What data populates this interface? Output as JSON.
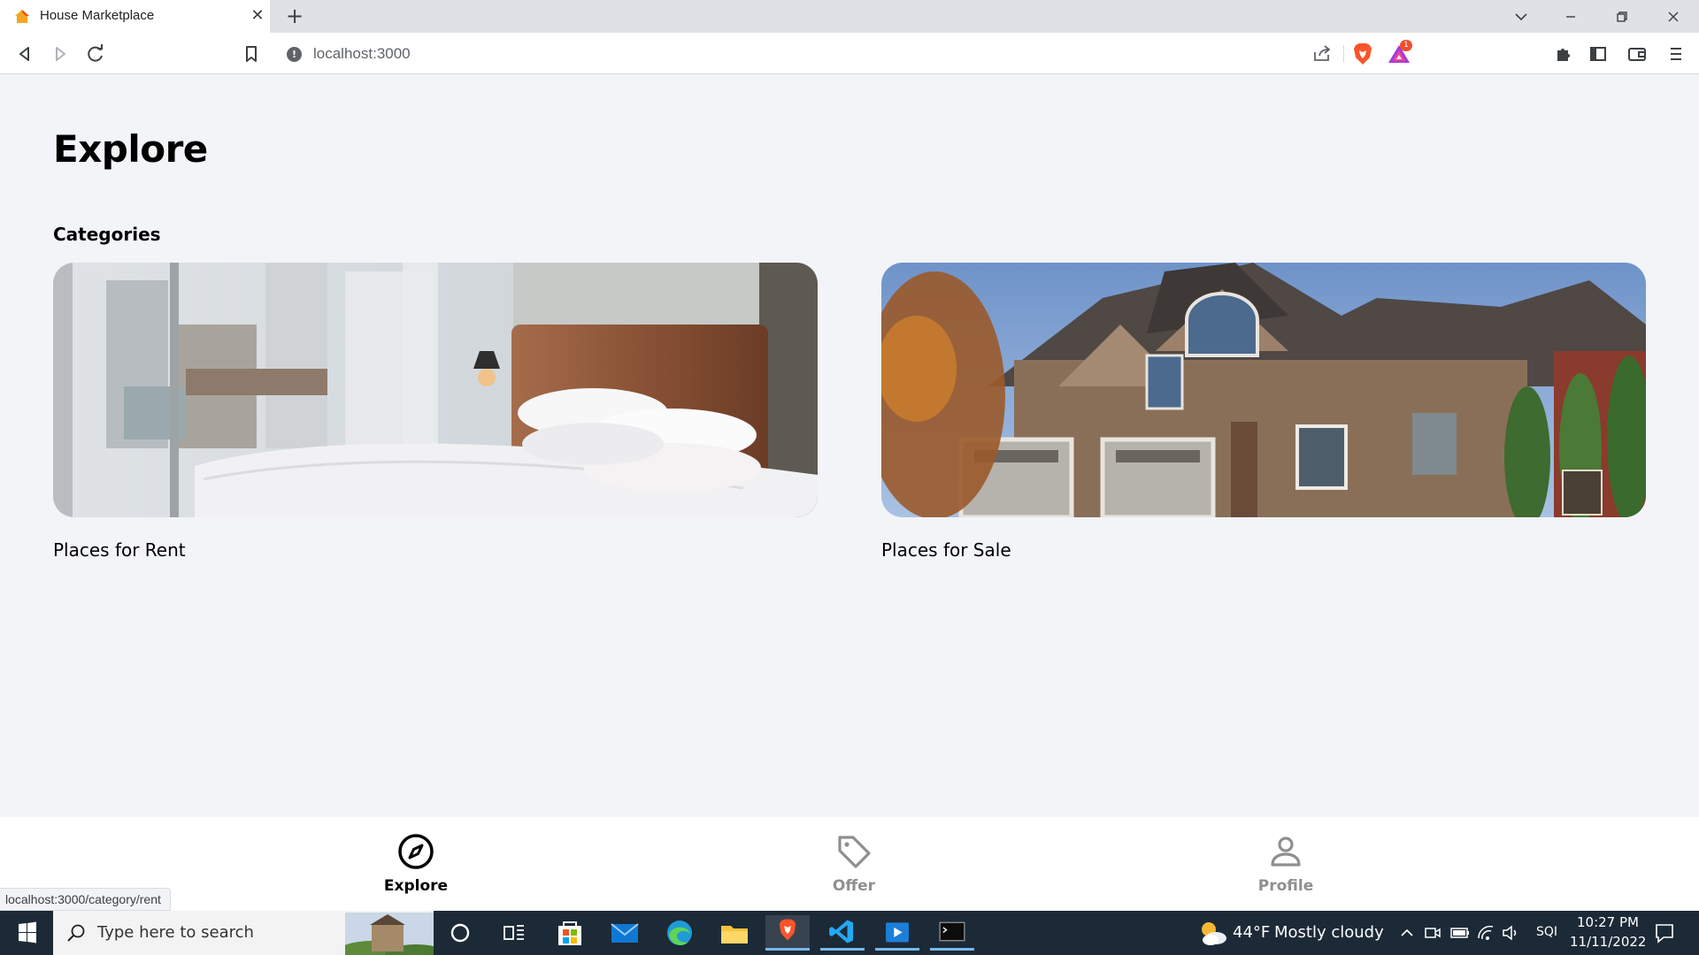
{
  "browser": {
    "tab_title": "House Marketplace",
    "url": "localhost:3000",
    "rewards_badge": "1",
    "status_url": "localhost:3000/category/rent"
  },
  "page": {
    "title": "Explore",
    "section_title": "Categories",
    "categories": [
      {
        "label": "Places for Rent"
      },
      {
        "label": "Places for Sale"
      }
    ]
  },
  "navbar": {
    "items": [
      {
        "label": "Explore",
        "icon": "compass-icon",
        "active": true
      },
      {
        "label": "Offer",
        "icon": "tag-icon",
        "active": false
      },
      {
        "label": "Profile",
        "icon": "person-icon",
        "active": false
      }
    ],
    "active_color": "#000000",
    "inactive_color": "#8f8f8f"
  },
  "taskbar": {
    "search_placeholder": "Type here to search",
    "weather_temp": "44°F",
    "weather_text": "Mostly cloudy",
    "language": "SQI",
    "time": "10:27 PM",
    "date": "11/11/2022"
  },
  "colors": {
    "page_background": "#f2f4f8",
    "taskbar": "#1c2a37",
    "accent": "#00cc66"
  }
}
